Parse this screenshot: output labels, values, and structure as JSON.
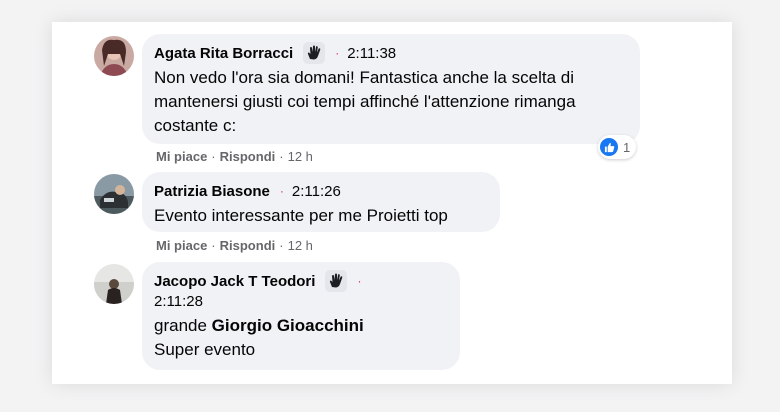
{
  "comments": [
    {
      "author": "Agata Rita Borracci",
      "time": "2:11:38",
      "text": "Non vedo l'ora sia domani! Fantastica anche la scelta di mantenersi giusti coi tempi affinché l'attenzione rimanga costante c:",
      "like_label": "Mi piace",
      "reply_label": "Rispondi",
      "age": "12 h",
      "reaction_count": "1"
    },
    {
      "author": "Patrizia Biasone",
      "time": "2:11:26",
      "text": "Evento interessante per me Proietti top",
      "like_label": "Mi piace",
      "reply_label": "Rispondi",
      "age": "12 h"
    },
    {
      "author": "Jacopo Jack T Teodori",
      "time": "2:11:28",
      "text_before": "grande ",
      "mention": "Giorgio Gioacchini",
      "text_after": "Super evento"
    }
  ],
  "separator": "·",
  "icons": {
    "badge": "wave-hand-icon",
    "reaction": "like-reaction-icon"
  },
  "colors": {
    "bubble": "#f0f2f5",
    "like_blue": "#1877f2",
    "meta_gray": "#65676b",
    "dot_pink": "#e0245e"
  }
}
